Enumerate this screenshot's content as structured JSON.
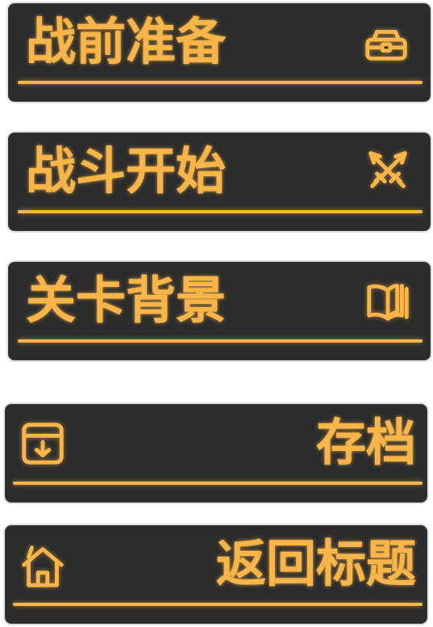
{
  "menu": {
    "items": [
      {
        "label": "战前准备",
        "icon": "toolbox-icon"
      },
      {
        "label": "战斗开始",
        "icon": "crossed-swords-icon"
      },
      {
        "label": "关卡背景",
        "icon": "open-book-icon"
      },
      {
        "label": "存档",
        "icon": "archive-download-icon"
      },
      {
        "label": "返回标题",
        "icon": "home-icon"
      }
    ]
  },
  "colors": {
    "accent": "#f7b54a",
    "button_bg": "#2c2c2c",
    "button_border": "#e3e3e3"
  }
}
